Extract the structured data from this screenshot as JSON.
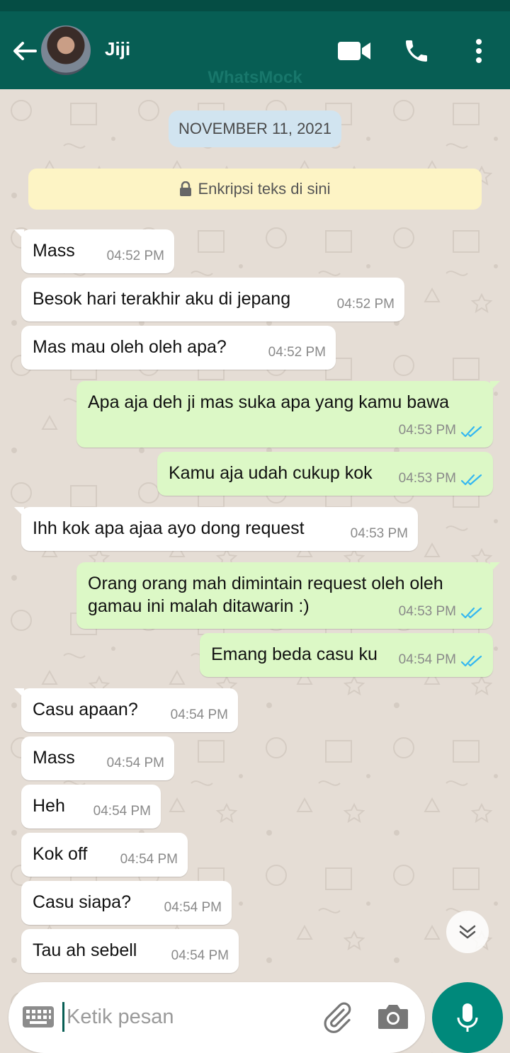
{
  "header": {
    "contact_name": "Jiji",
    "watermark": "WhatsMock"
  },
  "chat": {
    "date_chip": "NOVEMBER 11, 2021",
    "encryption_notice": "Enkripsi teks di sini",
    "messages": [
      {
        "dir": "in",
        "text": "Mass",
        "time": "04:52 PM"
      },
      {
        "dir": "in",
        "text": "Besok hari terakhir aku di jepang",
        "time": "04:52 PM"
      },
      {
        "dir": "in",
        "text": "Mas mau oleh oleh apa?",
        "time": "04:52 PM"
      },
      {
        "dir": "out",
        "text": "Apa aja deh ji mas suka apa yang kamu bawa",
        "time": "04:53 PM",
        "read": true
      },
      {
        "dir": "out",
        "text": "Kamu aja udah cukup kok",
        "time": "04:53 PM",
        "read": true
      },
      {
        "dir": "in",
        "text": "Ihh kok apa ajaa ayo dong request",
        "time": "04:53 PM"
      },
      {
        "dir": "out",
        "text": "Orang orang mah dimintain request oleh oleh\ngamau ini malah ditawarin :)",
        "time": "04:53 PM",
        "read": true
      },
      {
        "dir": "out",
        "text": "Emang beda casu ku",
        "time": "04:54 PM",
        "read": true
      },
      {
        "dir": "in",
        "text": "Casu apaan?",
        "time": "04:54 PM"
      },
      {
        "dir": "in",
        "text": "Mass",
        "time": "04:54 PM"
      },
      {
        "dir": "in",
        "text": "Heh",
        "time": "04:54 PM"
      },
      {
        "dir": "in",
        "text": "Kok off",
        "time": "04:54 PM"
      },
      {
        "dir": "in",
        "text": "Casu siapa?",
        "time": "04:54 PM"
      },
      {
        "dir": "in",
        "text": "Tau ah sebell",
        "time": "04:54 PM"
      }
    ]
  },
  "composer": {
    "placeholder": "Ketik pesan"
  },
  "colors": {
    "header": "#075e54",
    "outgoing_bubble": "#dcf8c6",
    "incoming_bubble": "#ffffff",
    "read_ticks": "#34b7f1",
    "mic_button": "#00897b",
    "chat_background": "#e5ddd5"
  },
  "icons": {
    "back": "arrow-left-icon",
    "video": "video-call-icon",
    "call": "phone-icon",
    "menu": "more-vert-icon",
    "lock": "lock-icon",
    "scroll": "chevron-double-down-icon",
    "keyboard": "keyboard-icon",
    "attach": "paperclip-icon",
    "camera": "camera-icon",
    "mic": "mic-icon"
  }
}
